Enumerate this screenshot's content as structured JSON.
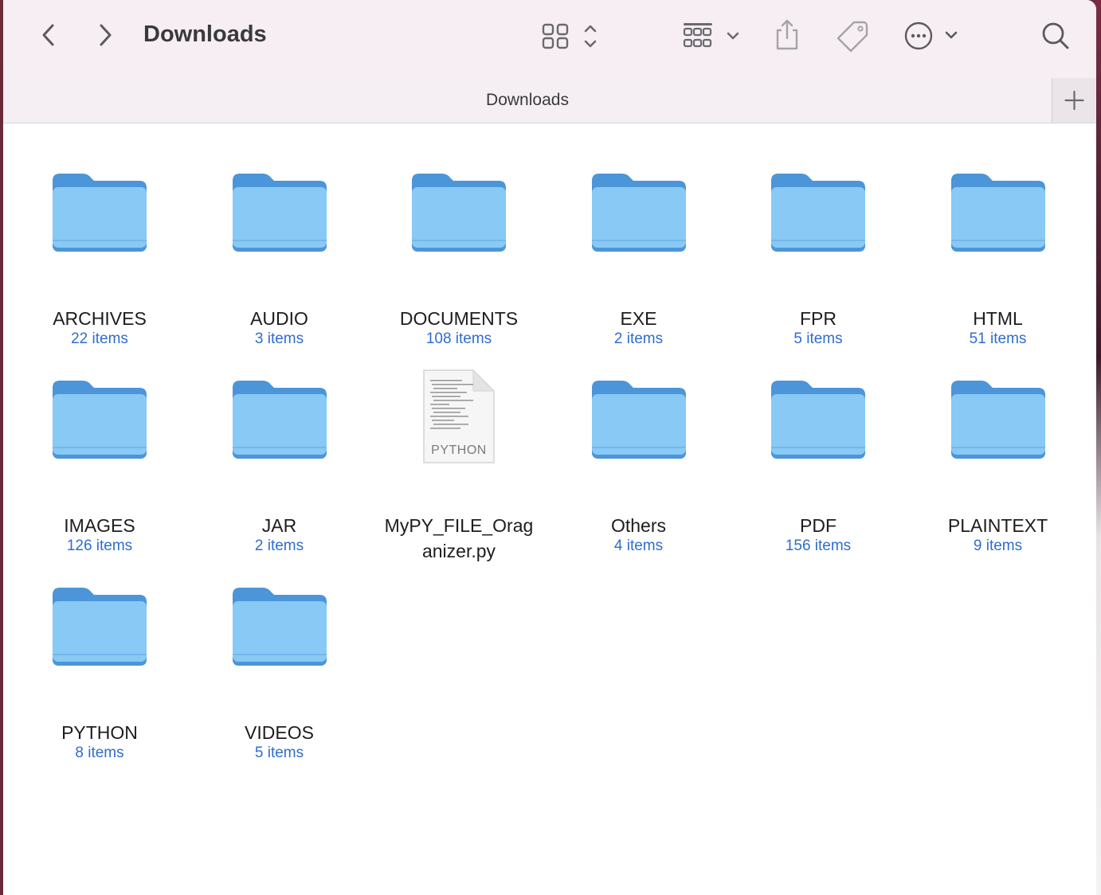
{
  "toolbar": {
    "title": "Downloads",
    "buttons": [
      "back-chevron",
      "forward-chevron",
      "icon-view-grid",
      "group-by",
      "share",
      "tag",
      "more-actions",
      "search"
    ]
  },
  "tab": {
    "title": "Downloads",
    "add_label": "+"
  },
  "items": [
    {
      "name": "ARCHIVES",
      "count": "22 items",
      "kind": "folder"
    },
    {
      "name": "AUDIO",
      "count": "3 items",
      "kind": "folder"
    },
    {
      "name": "DOCUMENTS",
      "count": "108 items",
      "kind": "folder"
    },
    {
      "name": "EXE",
      "count": "2 items",
      "kind": "folder"
    },
    {
      "name": "FPR",
      "count": "5 items",
      "kind": "folder"
    },
    {
      "name": "HTML",
      "count": "51 items",
      "kind": "folder"
    },
    {
      "name": "IMAGES",
      "count": "126 items",
      "kind": "folder"
    },
    {
      "name": "JAR",
      "count": "2 items",
      "kind": "folder"
    },
    {
      "name": "MyPY_FILE_Oraganizer.py",
      "name_lines": [
        "MyPY_FILE_Orag",
        "anizer.py"
      ],
      "count": "",
      "kind": "file",
      "badge": "PYTHON"
    },
    {
      "name": "Others",
      "count": "4 items",
      "kind": "folder"
    },
    {
      "name": "PDF",
      "count": "156 items",
      "kind": "folder"
    },
    {
      "name": "PLAINTEXT",
      "count": "9 items",
      "kind": "folder"
    },
    {
      "name": "PYTHON",
      "count": "8 items",
      "kind": "folder"
    },
    {
      "name": "VIDEOS",
      "count": "5 items",
      "kind": "folder"
    }
  ],
  "colors": {
    "folder_dark": "#4c95d9",
    "folder_light": "#88c9f5",
    "count_text": "#2e6dd0"
  }
}
